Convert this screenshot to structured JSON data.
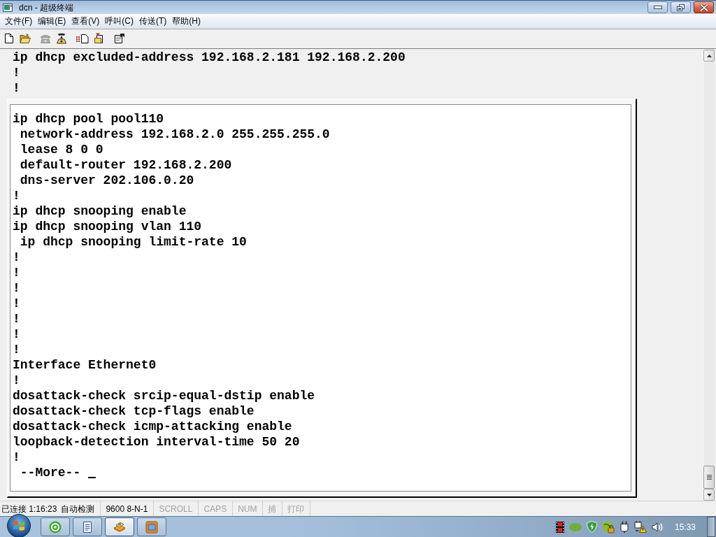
{
  "window": {
    "title": "dcn - 超级终端"
  },
  "menu_bar": [
    "文件(F)",
    "编辑(E)",
    "查看(V)",
    "呼叫(C)",
    "传送(T)",
    "帮助(H)"
  ],
  "toolbar": {
    "groups": [
      {
        "buttons": [
          {
            "kind": "new",
            "disabled": false
          },
          {
            "kind": "open",
            "disabled": false
          }
        ]
      },
      {
        "buttons": [
          {
            "kind": "call",
            "disabled": true
          },
          {
            "kind": "disconnect",
            "disabled": false
          }
        ]
      },
      {
        "buttons": [
          {
            "kind": "send",
            "disabled": false
          },
          {
            "kind": "receive",
            "disabled": false
          }
        ]
      },
      {
        "buttons": [
          {
            "kind": "properties",
            "disabled": false
          }
        ]
      }
    ]
  },
  "terminal": {
    "lines": [
      {
        "text": "ip dhcp excluded-address 192.168.2.181 192.168.2.200",
        "indented": false
      },
      {
        "text": "!",
        "indented": false
      },
      {
        "text": "!",
        "indented": false
      }
    ],
    "panel": {
      "lines": [
        {
          "text": "ip dhcp pool pool110",
          "indented": false
        },
        {
          "text": "network-address 192.168.2.0 255.255.255.0",
          "indented": true
        },
        {
          "text": "lease 8 0 0",
          "indented": true
        },
        {
          "text": "default-router 192.168.2.200",
          "indented": true
        },
        {
          "text": "dns-server 202.106.0.20",
          "indented": true
        },
        {
          "text": "!",
          "indented": false
        },
        {
          "text": "ip dhcp snooping enable",
          "indented": false
        },
        {
          "text": "ip dhcp snooping vlan 110",
          "indented": false
        },
        {
          "text": "ip dhcp snooping limit-rate 10",
          "indented": true
        },
        {
          "text": "!",
          "indented": false
        },
        {
          "text": "!",
          "indented": false
        },
        {
          "text": "!",
          "indented": false
        },
        {
          "text": "!",
          "indented": false
        },
        {
          "text": "!",
          "indented": false
        },
        {
          "text": "!",
          "indented": false
        },
        {
          "text": "!",
          "indented": false
        },
        {
          "text": "Interface Ethernet0",
          "indented": false
        },
        {
          "text": "!",
          "indented": false
        },
        {
          "text": "dosattack-check srcip-equal-dstip enable",
          "indented": false
        },
        {
          "text": "dosattack-check tcp-flags enable",
          "indented": false
        },
        {
          "text": "dosattack-check icmp-attacking enable",
          "indented": false
        },
        {
          "text": "loopback-detection interval-time 50 20",
          "indented": false
        },
        {
          "text": "!",
          "indented": false
        },
        {
          "text": "--More--",
          "indented": true
        }
      ],
      "cursor": true
    }
  },
  "status_bar": {
    "panes": [
      {
        "kind": "info",
        "texts": [
          "已连接 1:16:23",
          "自动检测"
        ]
      },
      {
        "kind": "info",
        "texts": [
          "9600 8-N-1"
        ]
      },
      {
        "kind": "indicator",
        "text": "SCROLL",
        "on": false
      },
      {
        "kind": "indicator",
        "text": "CAPS",
        "on": false
      },
      {
        "kind": "indicator",
        "text": "NUM",
        "on": false
      },
      {
        "kind": "indicator",
        "text": "捕",
        "on": false
      },
      {
        "kind": "indicator",
        "text": "打印",
        "on": false
      }
    ]
  },
  "taskbar": {
    "buttons": [
      {
        "kind": "browser",
        "selected": false
      },
      {
        "kind": "document",
        "selected": false
      },
      {
        "kind": "terminal",
        "selected": true
      },
      {
        "kind": "window",
        "selected": false
      }
    ],
    "clock": "15:33"
  }
}
